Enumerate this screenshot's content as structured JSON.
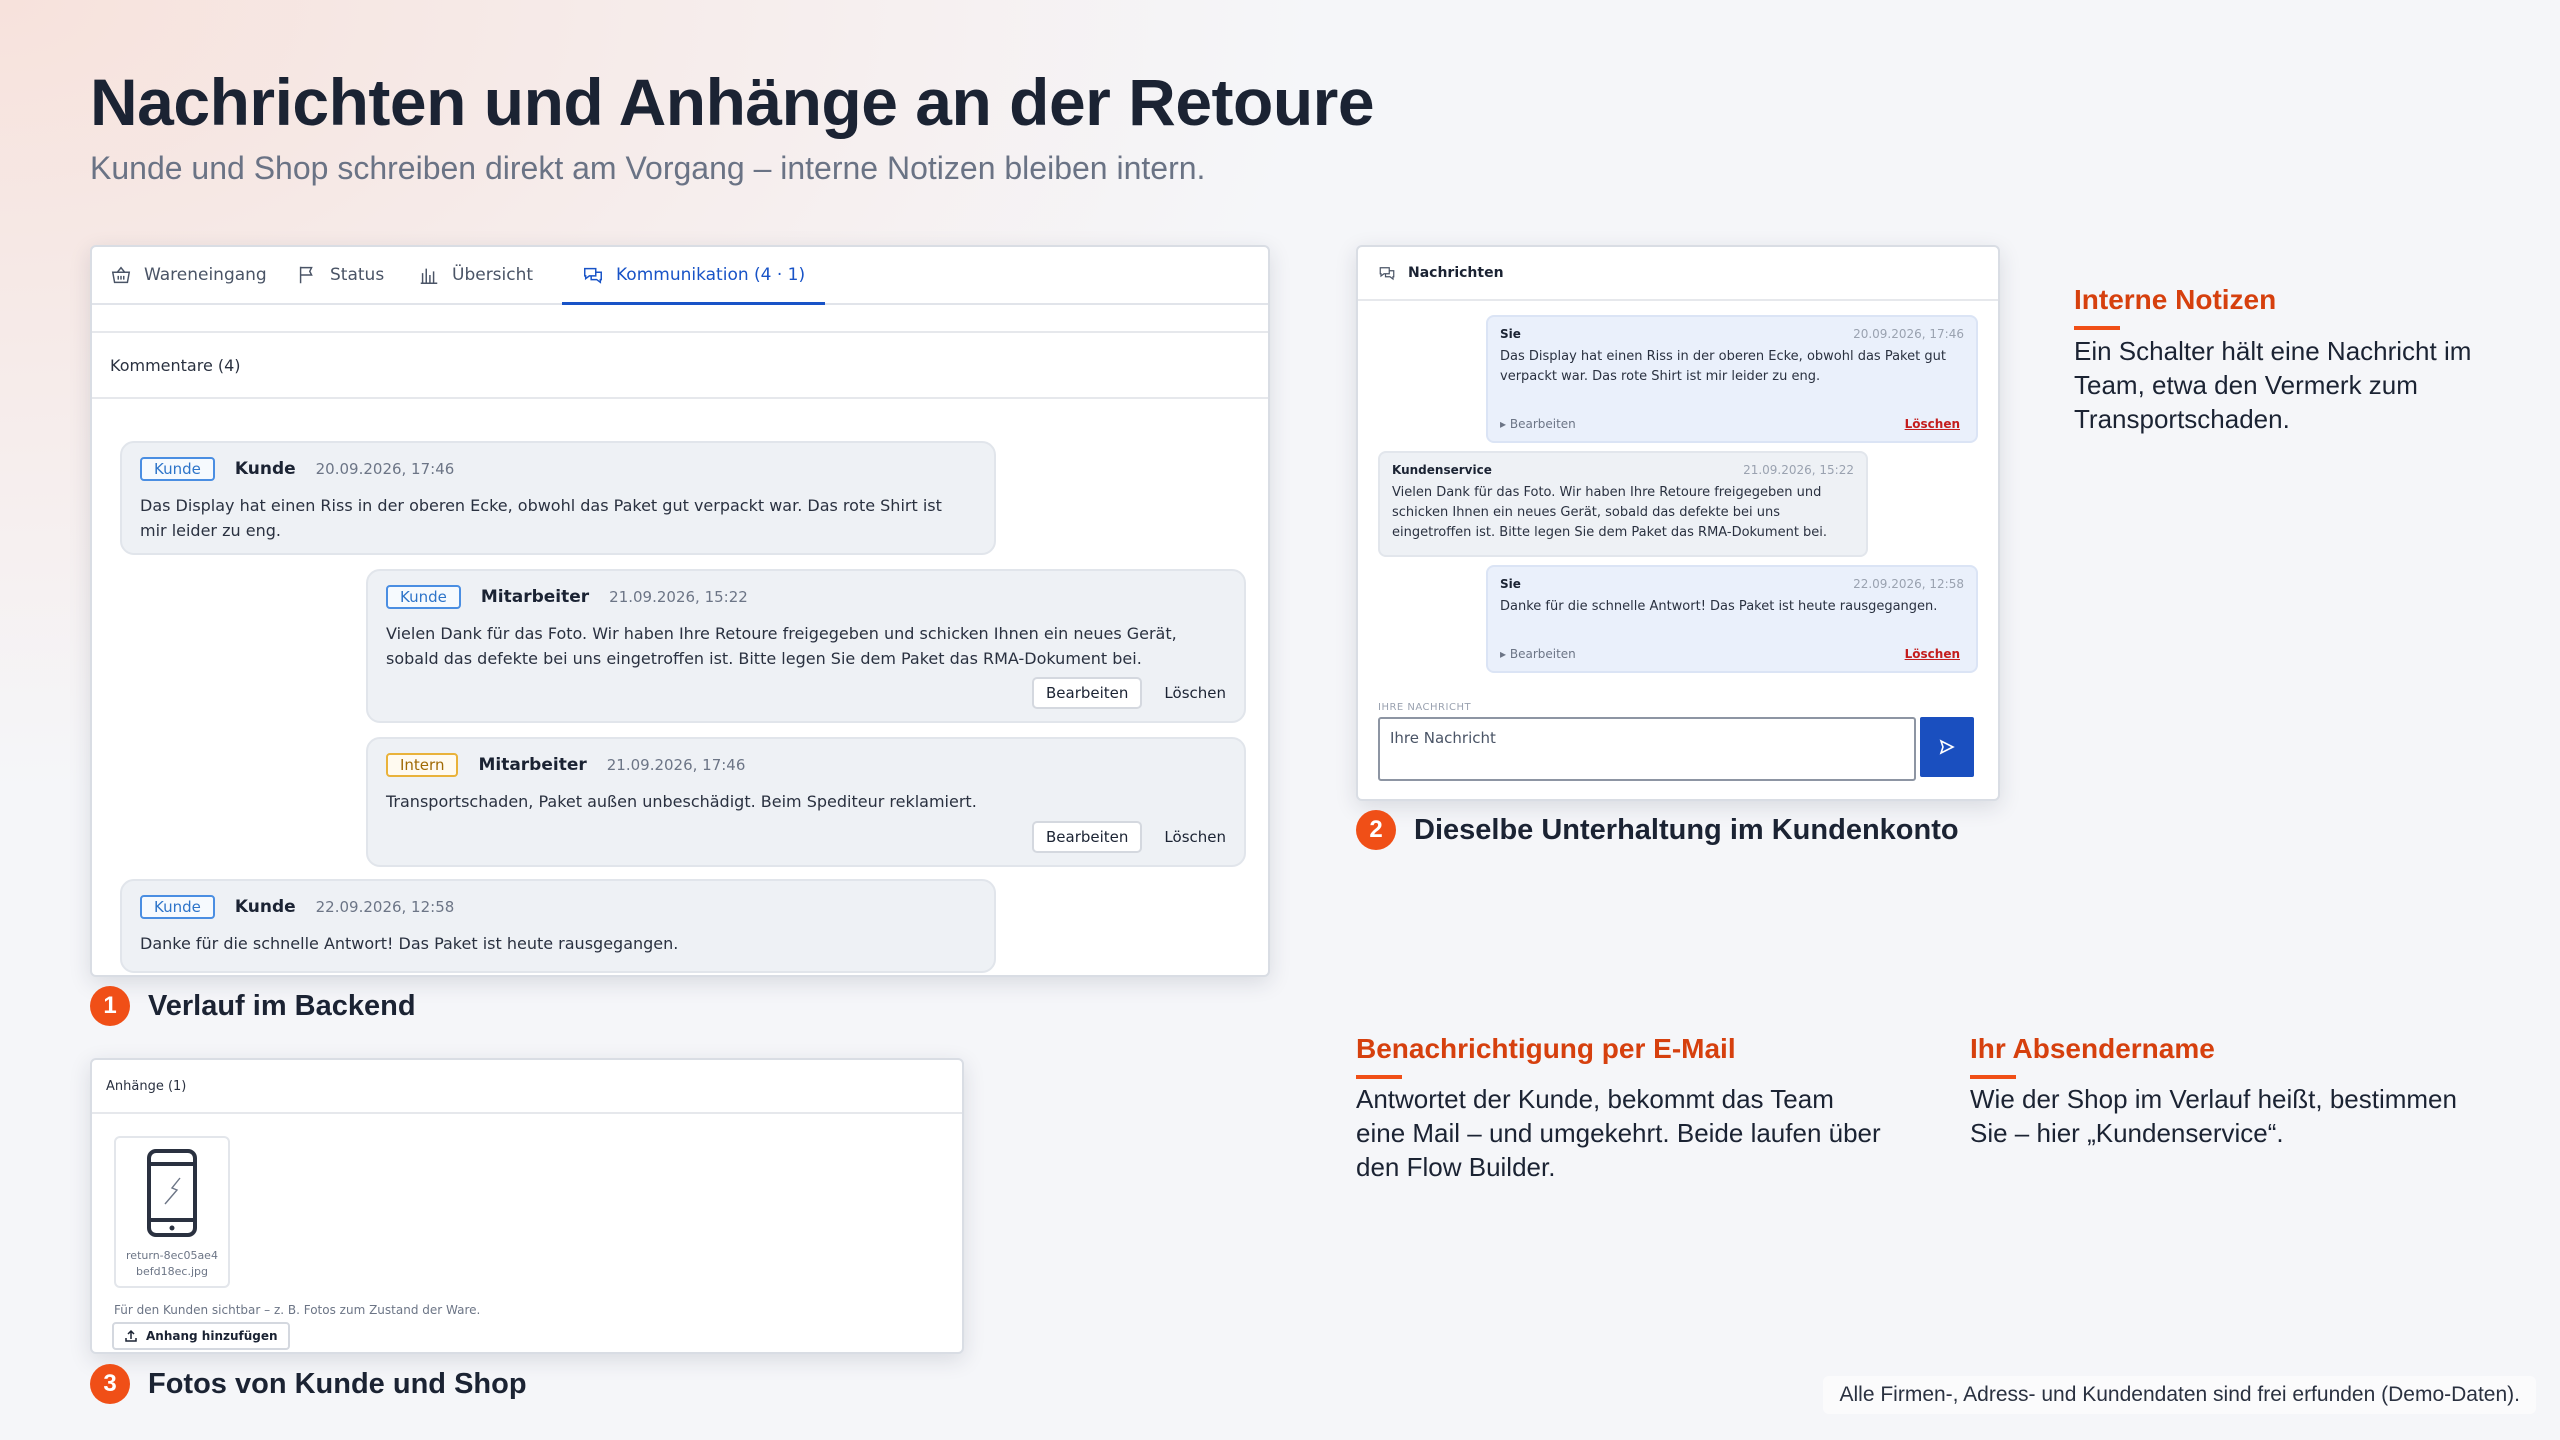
{
  "hero": {
    "title": "Nachrichten und Anhänge an der Retoure",
    "subtitle": "Kunde und Shop schreiben direkt am Vorgang – interne Notizen bleiben intern."
  },
  "backend": {
    "tabs": [
      {
        "label": "Wareneingang",
        "icon": "basket-icon"
      },
      {
        "label": "Status",
        "icon": "flag-icon"
      },
      {
        "label": "Übersicht",
        "icon": "bar-chart-icon"
      },
      {
        "label": "Kommunikation (4 · 1)",
        "icon": "chat-icon",
        "active": true
      }
    ],
    "comments_heading": "Kommentare (4)",
    "messages": [
      {
        "tag": "Kunde",
        "author": "Kunde",
        "date": "20.09.2026, 17:46",
        "text": "Das Display hat einen Riss in der oberen Ecke, obwohl das Paket gut verpackt war. Das rote Shirt ist mir leider zu eng."
      },
      {
        "tag": "Kunde",
        "author": "Mitarbeiter",
        "date": "21.09.2026, 15:22",
        "text": "Vielen Dank für das Foto. Wir haben Ihre Retoure freigegeben und schicken Ihnen ein neues Gerät, sobald das defekte bei uns eingetroffen ist. Bitte legen Sie dem Paket das RMA-Dokument bei.",
        "edit": "Bearbeiten",
        "delete": "Löschen"
      },
      {
        "tag": "Intern",
        "author": "Mitarbeiter",
        "date": "21.09.2026, 17:46",
        "text": "Transportschaden, Paket außen unbeschädigt. Beim Spediteur reklamiert.",
        "edit": "Bearbeiten",
        "delete": "Löschen"
      },
      {
        "tag": "Kunde",
        "author": "Kunde",
        "date": "22.09.2026, 12:58",
        "text": "Danke für die schnelle Antwort! Das Paket ist heute rausgegangen."
      }
    ]
  },
  "captions": [
    {
      "num": "1",
      "text": "Verlauf im Backend"
    },
    {
      "num": "2",
      "text": "Dieselbe Unterhaltung im Kundenkonto"
    },
    {
      "num": "3",
      "text": "Fotos von Kunde und Shop"
    }
  ],
  "attachments": {
    "heading": "Anhänge (1)",
    "file_name_line1": "return-8ec05ae4",
    "file_name_line2": "befd18ec.jpg",
    "note": "Für den Kunden sichtbar – z. B. Fotos zum Zustand der Ware.",
    "add_button": "Anhang hinzufügen"
  },
  "customer": {
    "heading": "Nachrichten",
    "messages": [
      {
        "author": "Sie",
        "date": "20.09.2026, 17:46",
        "text": "Das Display hat einen Riss in der oberen Ecke, obwohl das Paket gut verpackt war. Das rote Shirt ist mir leider zu eng.",
        "edit": "Bearbeiten",
        "delete": "Löschen"
      },
      {
        "author": "Kundenservice",
        "date": "21.09.2026, 15:22",
        "text": "Vielen Dank für das Foto. Wir haben Ihre Retoure freigegeben und schicken Ihnen ein neues Gerät, sobald das defekte bei uns eingetroffen ist. Bitte legen Sie dem Paket das RMA-Dokument bei."
      },
      {
        "author": "Sie",
        "date": "22.09.2026, 12:58",
        "text": "Danke für die schnelle Antwort! Das Paket ist heute rausgegangen.",
        "edit": "Bearbeiten",
        "delete": "Löschen"
      }
    ],
    "input_label": "IHRE NACHRICHT",
    "input_placeholder": "Ihre Nachricht"
  },
  "info": [
    {
      "title": "Interne Notizen",
      "text": "Ein Schalter hält eine Nachricht im Team, etwa den Vermerk zum Transportschaden."
    },
    {
      "title": "Benachrichtigung per E-Mail",
      "text": "Antwortet der Kunde, bekommt das Team eine Mail – und umgekehrt. Beide laufen über den Flow Builder."
    },
    {
      "title": "Ihr Absendername",
      "text": "Wie der Shop im Verlauf heißt, bestimmen Sie – hier „Kundenservice“."
    }
  ],
  "footer_note": "Alle Firmen-, Adress- und Kundendaten sind frei erfunden (Demo-Daten).",
  "colors": {
    "accent": "#f04f17",
    "link": "#1853c7",
    "send_button": "#1a4fbf",
    "delete": "#c41d1d"
  }
}
